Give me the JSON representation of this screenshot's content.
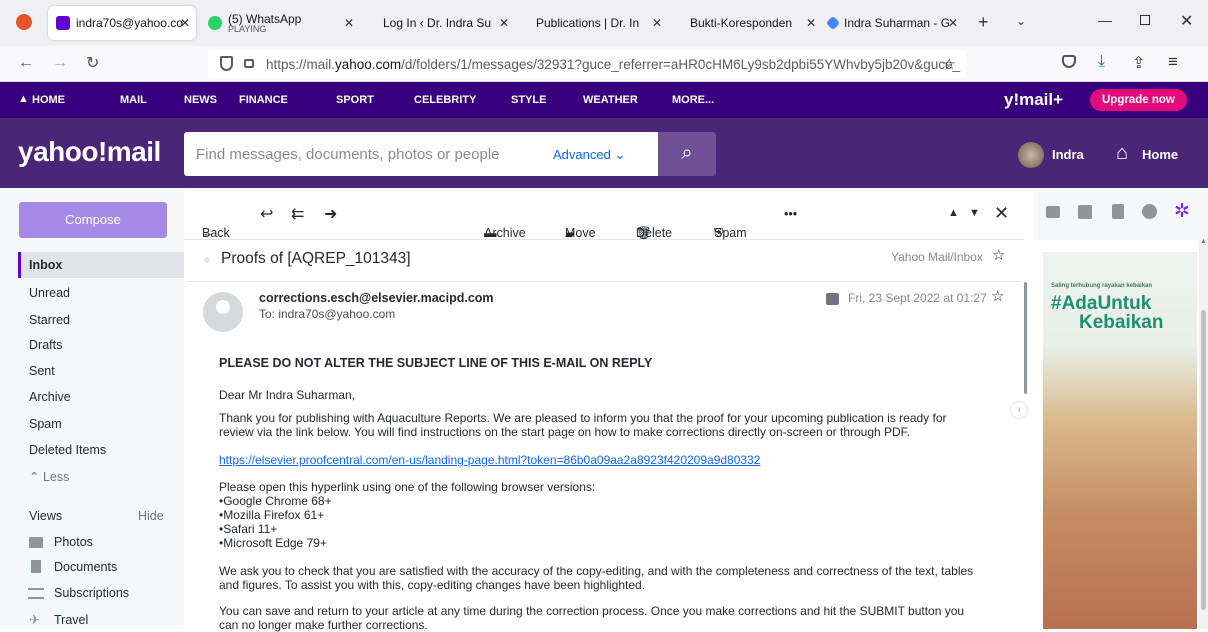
{
  "browser": {
    "tabs": [
      {
        "label": "indra70s@yahoo.co",
        "sub": ""
      },
      {
        "label": "(5) WhatsApp",
        "sub": "PLAYING"
      },
      {
        "label": "Log In ‹ Dr. Indra Su",
        "sub": ""
      },
      {
        "label": "Publications | Dr. In",
        "sub": ""
      },
      {
        "label": "Bukti-Koresponden",
        "sub": ""
      },
      {
        "label": "Indra Suharman - G",
        "sub": ""
      }
    ],
    "url_prefix": "https://mail.",
    "url_domain": "yahoo.com",
    "url_rest": "/d/folders/1/messages/32931?guce_referrer=aHR0cHM6Ly9sb2dpbi55YWhvby5jb20v&guce_"
  },
  "yahoo_nav": {
    "items": [
      "HOME",
      "MAIL",
      "NEWS",
      "FINANCE",
      "SPORT",
      "CELEBRITY",
      "STYLE",
      "WEATHER",
      "MORE..."
    ],
    "brand": "y!mail+",
    "upgrade": "Upgrade now"
  },
  "header": {
    "logo": "yahoo!mail",
    "search_placeholder": "Find messages, documents, photos or people",
    "advanced": "Advanced",
    "user": "Indra",
    "home": "Home"
  },
  "sidebar": {
    "compose": "Compose",
    "folders": [
      "Inbox",
      "Unread",
      "Starred",
      "Drafts",
      "Sent",
      "Archive",
      "Spam",
      "Deleted Items"
    ],
    "less": "Less",
    "views_label": "Views",
    "hide": "Hide",
    "views": [
      "Photos",
      "Documents",
      "Subscriptions",
      "Travel"
    ]
  },
  "toolbar": {
    "back": "Back",
    "archive": "Archive",
    "move": "Move",
    "delete": "Delete",
    "spam": "Spam",
    "more": "•••"
  },
  "message": {
    "subject": "Proofs of [AQREP_101343]",
    "folder": "Yahoo Mail/Inbox",
    "from": "corrections.esch@elsevier.macipd.com",
    "to": "To: indra70s@yahoo.com",
    "date": "Fri, 23 Sept 2022 at 01:27",
    "body": {
      "heading": "PLEASE DO NOT ALTER THE SUBJECT LINE OF THIS E-MAIL ON REPLY",
      "greeting": "Dear Mr Indra Suharman,",
      "para1a": "Thank you for publishing with Aquaculture Reports. We are pleased to inform you that the proof for your upcoming publication is ready for",
      "para1b": "review via the link below. You will find instructions on the start page on how to make corrections directly on-screen or through PDF.",
      "link": "https://elsevier.proofcentral.com/en-us/landing-page.html?token=86b0a09aa2a8923f420209a9d80332",
      "para2": "Please open this hyperlink using one of the following browser versions:",
      "browsers": [
        "•Google Chrome 68+",
        "•Mozilla Firefox 61+",
        "•Safari 11+",
        "•Microsoft Edge 79+"
      ],
      "para3a": "We ask you to check that you are satisfied with the accuracy of the copy-editing, and with the completeness and correctness of the text, tables",
      "para3b": "and figures. To assist you with this, copy-editing changes have been highlighted.",
      "para4a": "You can save and return to your article at any time during the correction process. Once you make corrections and hit the SUBMIT button you",
      "para4b": "can no longer make further corrections."
    }
  },
  "ad": {
    "tagline": "Saling terhubung rayakan kebaikan",
    "hashtag1": "#AdaUntuk",
    "hashtag2": "Kebaikan"
  },
  "colors": {
    "yahoo_purple": "#39007d",
    "header_purple": "#4b2578",
    "compose": "#a68ae8",
    "upgrade": "#e30b7c",
    "link": "#0f69ff"
  }
}
